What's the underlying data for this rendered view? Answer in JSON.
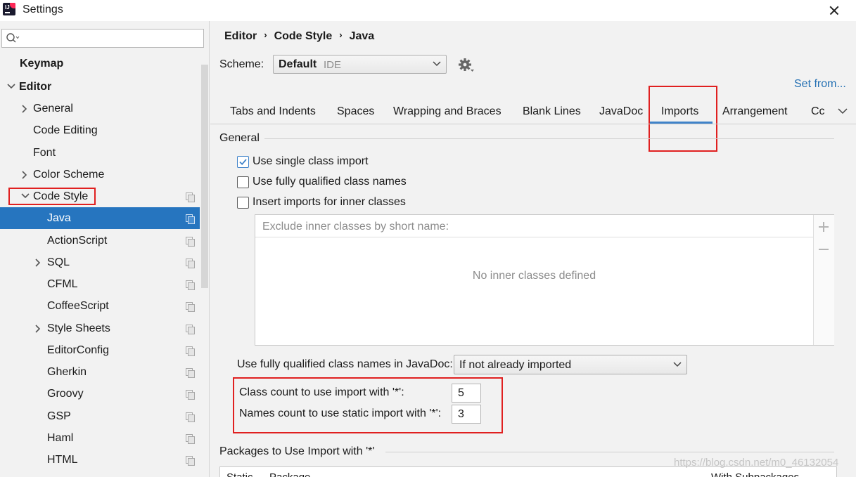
{
  "window": {
    "title": "Settings"
  },
  "sidebar": {
    "search": {
      "value": "",
      "placeholder": ""
    },
    "items": [
      {
        "label": "Keymap",
        "bold": true
      },
      {
        "label": "Editor",
        "bold": true,
        "expanded": true
      },
      {
        "label": "General",
        "collapsed": true
      },
      {
        "label": "Code Editing"
      },
      {
        "label": "Font"
      },
      {
        "label": "Color Scheme",
        "collapsed": true
      },
      {
        "label": "Code Style",
        "expanded": true
      },
      {
        "label": "Java",
        "selected": true
      },
      {
        "label": "ActionScript"
      },
      {
        "label": "SQL",
        "collapsed": true
      },
      {
        "label": "CFML"
      },
      {
        "label": "CoffeeScript"
      },
      {
        "label": "Style Sheets",
        "collapsed": true
      },
      {
        "label": "EditorConfig"
      },
      {
        "label": "Gherkin"
      },
      {
        "label": "Groovy"
      },
      {
        "label": "GSP"
      },
      {
        "label": "Haml"
      },
      {
        "label": "HTML"
      }
    ]
  },
  "breadcrumb": [
    "Editor",
    "Code Style",
    "Java"
  ],
  "scheme": {
    "label": "Scheme:",
    "value": "Default",
    "sub": "IDE"
  },
  "set_from": "Set from...",
  "tabs": [
    "Tabs and Indents",
    "Spaces",
    "Wrapping and Braces",
    "Blank Lines",
    "JavaDoc",
    "Imports",
    "Arrangement",
    "Cc"
  ],
  "active_tab": "Imports",
  "general": {
    "title": "General",
    "checkboxes": [
      {
        "label": "Use single class import",
        "checked": true
      },
      {
        "label": "Use fully qualified class names",
        "checked": false
      },
      {
        "label": "Insert imports for inner classes",
        "checked": false
      }
    ],
    "exclude_header": "Exclude inner classes by short name:",
    "exclude_empty": "No inner classes defined",
    "javadoc_label": "Use fully qualified class names in JavaDoc:",
    "javadoc_value": "If not already imported",
    "class_count_label": "Class count to use import with '*':",
    "class_count_value": "5",
    "names_count_label": "Names count to use static import with '*':",
    "names_count_value": "3"
  },
  "packages": {
    "title": "Packages to Use Import with '*'",
    "columns": [
      "Static",
      "Package",
      "With Subpackages"
    ]
  },
  "watermark": "https://blog.csdn.net/m0_46132054",
  "colors": {
    "selection": "#2675bf",
    "accent": "#4083c9",
    "highlight_box": "#e02020",
    "link": "#2470b3"
  }
}
